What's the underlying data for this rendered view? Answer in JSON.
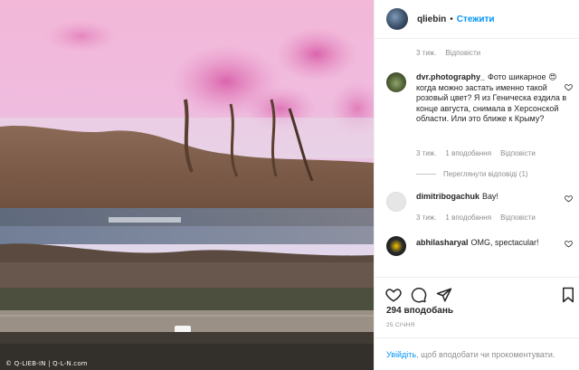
{
  "photo": {
    "alt_icon": "aerial-pink-lake-photo",
    "watermark": "© Q-LIEB-IN | Q-L-N.com"
  },
  "header": {
    "username": "qliebin",
    "separator": "•",
    "follow_label": "Стежити"
  },
  "caption_meta": {
    "time": "3 тиж.",
    "reply": "Відповісти"
  },
  "comments": [
    {
      "username": "dvr.photography_",
      "text": "Фото шикарное 😍 когда можно застать именно такой розовый цвет? Я из Геническа ездила в конце августа, снимала в Херсонской области. Или это ближе к Крыму?",
      "time": "3 тиж.",
      "likes": "1 вподобання",
      "reply": "Відповісти",
      "view_replies": "Переглянути відповіді (1)"
    },
    {
      "username": "dimitribogachuk",
      "text": "Вау!",
      "time": "3 тиж.",
      "likes": "1 вподобання",
      "reply": "Відповісти"
    },
    {
      "username": "abhilasharyal",
      "text": "OMG, spectacular!"
    }
  ],
  "actions": {
    "likes": "294 вподобань",
    "date": "25 січня"
  },
  "footer": {
    "login_link": "Увійдіть",
    "rest": ", щоб вподобати чи прокоментувати."
  },
  "colors": {
    "link": "#0095f6",
    "muted": "#8e8e8e",
    "text": "#262626"
  }
}
